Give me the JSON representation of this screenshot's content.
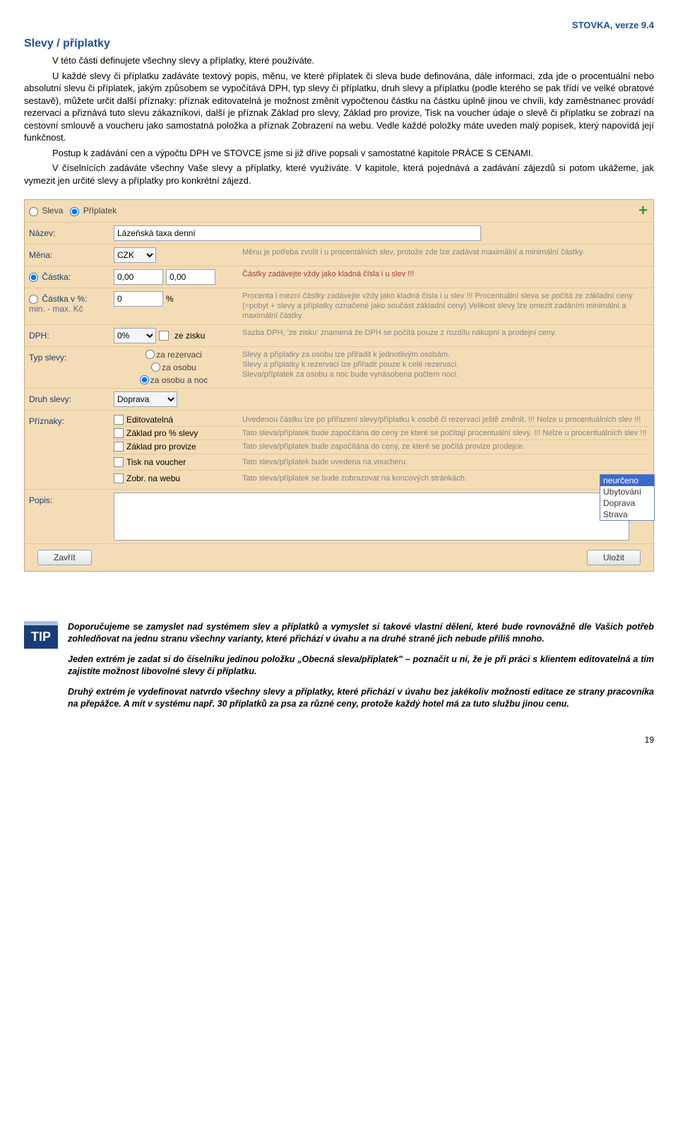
{
  "header_version": "STOVKA, verze 9.4",
  "section_title": "Slevy / příplatky",
  "para1": "V této části definujete všechny slevy a příplatky, které používáte.",
  "para2": "U každé slevy či příplatku zadáváte textový popis, měnu, ve které příplatek či sleva bude definována, dále informaci, zda jde o procentuální nebo absolutní slevu či příplatek, jakým způsobem se vypočítává DPH, typ slevy či příplatku, druh slevy a příplatku (podle kterého se pak třídí ve velké obratové sestavě), můžete určit další příznaky: příznak editovatelná je možnost změnit vypočtenou částku na částku úplně jinou ve chvíli, kdy zaměstnanec provádí rezervaci a přiznává tuto slevu zákazníkovi, další je příznak Základ pro slevy, Základ pro provize, Tisk na voucher údaje o slevě či příplatku se zobrazí na cestovní smlouvě a voucheru jako samostatná položka a příznak Zobrazení na webu.  Vedle každé položky máte uveden malý popisek, který napovídá její funkčnost.",
  "para3": "Postup  k zadávání cen a výpočtu DPH ve STOVCE jsme si již dříve popsali v samostatné kapitole PRÁCE S CENAMI.",
  "para4": "V číselnících zadáváte všechny Vaše slevy a příplatky, které využíváte. V kapitole, která pojednává a zadávání zájezdů si potom ukážeme, jak vymezit jen určité slevy a příplatky pro konkrétní zájezd.",
  "form": {
    "type_sleva": "Sleva",
    "type_priplatek": "Příplatek",
    "lbl_nazev": "Název:",
    "val_nazev": "Lázeňská taxa denní",
    "lbl_mena": "Měna:",
    "val_mena": "CZK",
    "help_mena": "Měnu je potřeba zvolit i u procentálních slev, protože zde lze zadávat maximální a minimální částky.",
    "lbl_castka": "Částka:",
    "val_castka1": "0,00",
    "val_castka2": "0,00",
    "help_castka": "Částky zadávejte vždy jako kladná čísla i u slev !!!",
    "lbl_castkapct": "Částka v %:",
    "lbl_castkapct_sub": "min. - max. Kč",
    "val_pct": "0",
    "pct_unit": "%",
    "help_pct": "Procenta i mezní částky zadávejte vždy jako kladná čísla i u slev !!! Procentuální sleva se počítá ze základní ceny (=pobyt + slevy a příplatky označené jako součást základní ceny) Velikost slevy lze omezit zadáním minimální a maximální částky.",
    "lbl_dph": "DPH:",
    "val_dph": "0%",
    "chk_zezisku": "ze zisku",
    "help_dph": "Sazba DPH, 'ze zisku' znamená že DPH se počítá pouze z rozdílu nákupní a prodejní ceny.",
    "lbl_typ": "Typ slevy:",
    "typ1": "za rezervaci",
    "typ2": "za osobu",
    "typ3": "za osobu a noc",
    "help_typ1": "Slevy a příplatky za osobu lze přiřadit k jednotlivým osobám.",
    "help_typ2": "Slevy a příplatky k rezervaci lze přiřadit pouze k celé rezervaci.",
    "help_typ3": "Sleva/příplatek za osobu a noc bude vynásobena počtem nocí.",
    "lbl_druh": "Druh slevy:",
    "val_druh": "Doprava",
    "lbl_priznaky": "Příznaky:",
    "pr1": "Editovatelná",
    "pr1_help": "Uvedenou částku lze po přiřazení slevy/příplatku k osobě či rezervaci ještě změnit. !!! Nelze u procentuálních slev !!!",
    "pr2": "Základ pro % slevy",
    "pr2_help": "Tato sleva/příplatek bude započítána do ceny ze které se počítají procentuální slevy. !!! Nelze u procentuálních slev !!!",
    "pr3": "Základ pro provize",
    "pr3_help": "Tato sleva/příplatek bude započítána do ceny, ze které se počítá provize prodejce.",
    "pr4": "Tisk na voucher",
    "pr4_help": "Tato sleva/příplatek bude uvedena na voucheru.",
    "pr5": "Zobr. na webu",
    "pr5_help": "Tato sleva/příplatek se bude zobrazovat na koncových stránkách.",
    "lbl_popis": "Popis:",
    "btn_zavrit": "Zavřít",
    "btn_ulozit": "Uložit",
    "dd": {
      "o1": "neurčeno",
      "o2": "Ubytování",
      "o3": "Doprava",
      "o4": "Strava"
    }
  },
  "tip_label": "TIP",
  "tip1": "Doporučujeme se zamyslet nad systémem slev a příplatků a vymyslet si takové vlastní dělení, které bude rovnovážně dle Vašich potřeb zohledňovat na jednu stranu všechny varianty, které přichází v úvahu a na druhé straně jich nebude příliš mnoho.",
  "tip2": "Jeden extrém je zadat si do číselníku jedinou položku „Obecná sleva/příplatek\" – poznačit u ní, že je při práci s klientem editovatelná a tím zajistíte možnost libovolné slevy či příplatku.",
  "tip3": "Druhý extrém je vydefinovat natvrdo všechny slevy a příplatky, které přichází v úvahu bez jakékoliv možnosti editace ze strany pracovníka na přepážce. A mít v systému např. 30 příplatků za psa za různé ceny, protože každý hotel má za tuto službu jinou cenu.",
  "page_num": "19"
}
